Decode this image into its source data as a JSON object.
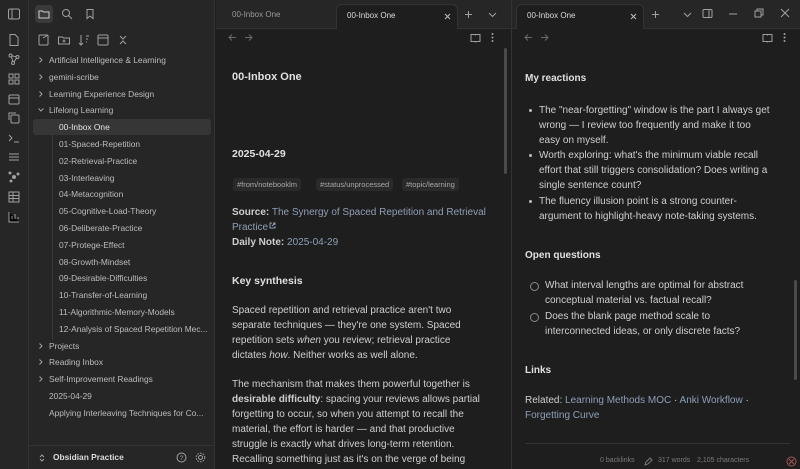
{
  "sidebar": {
    "items": [
      {
        "label": "Artificial Intelligence & Learning"
      },
      {
        "label": "gemini-scribe"
      },
      {
        "label": "Learning Experience Design"
      },
      {
        "label": "Lifelong Learning"
      },
      {
        "label": "00-Inbox One"
      },
      {
        "label": "01-Spaced-Repetition"
      },
      {
        "label": "02-Retrieval-Practice"
      },
      {
        "label": "03-Interleaving"
      },
      {
        "label": "04-Metacognition"
      },
      {
        "label": "05-Cognitive-Load-Theory"
      },
      {
        "label": "06-Deliberate-Practice"
      },
      {
        "label": "07-Protege-Effect"
      },
      {
        "label": "08-Growth-Mindset"
      },
      {
        "label": "09-Desirable-Difficulties"
      },
      {
        "label": "10-Transfer-of-Learning"
      },
      {
        "label": "11-Algorithmic-Memory-Models"
      },
      {
        "label": "12-Analysis of Spaced Repetition Mec..."
      },
      {
        "label": "Projects"
      },
      {
        "label": "Reading Inbox"
      },
      {
        "label": "Self-Improvement Readings"
      },
      {
        "label": "2025-04-29"
      },
      {
        "label": "Applying Interleaving Techniques for Co..."
      }
    ],
    "vault_name": "Obsidian Practice"
  },
  "left_pane": {
    "tabs": [
      {
        "label": "00-Inbox One"
      },
      {
        "label": "00-Inbox One"
      }
    ],
    "note_title": "00-Inbox One",
    "date_heading": "2025-04-29",
    "tags": [
      "#from/notebooklm",
      "#status/unprocessed",
      "#topic/learning"
    ],
    "source_label": "Source:",
    "source_link_line1": "The Synergy of Spaced Repetition and Retrieval",
    "source_link_line2": "Practice",
    "daily_note_label": "Daily Note:",
    "daily_note_link": "2025-04-29",
    "key_synthesis_heading": "Key synthesis",
    "para1": [
      "Spaced repetition and retrieval practice aren't two",
      "separate techniques — they're one system. Spaced",
      "repetition sets ",
      "when",
      " you review; retrieval practice",
      "dictates ",
      "how",
      ". Neither works as well alone."
    ],
    "para2": [
      "The mechanism that makes them powerful together is",
      "desirable difficulty",
      ": spacing your reviews allows partial",
      "forgetting to occur, so when you attempt to recall the",
      "material, the effort is harder — and that productive",
      "struggle is exactly what drives long-term retention.",
      "Recalling something just as it's on the verge of being"
    ]
  },
  "right_pane": {
    "tab_label": "00-Inbox One",
    "reactions_heading": "My reactions",
    "reactions": [
      [
        "The \"near-forgetting\" window is the part I always get",
        "wrong — I review too frequently and make it too",
        "easy on myself."
      ],
      [
        "Worth exploring: what's the minimum viable recall",
        "effort that still triggers consolidation? Does writing a",
        "single sentence count?"
      ],
      [
        "The fluency illusion point is a strong counter-",
        "argument to highlight-heavy note-taking systems."
      ]
    ],
    "open_questions_heading": "Open questions",
    "questions": [
      [
        "What interval lengths are optimal for abstract",
        "conceptual material vs. factual recall?"
      ],
      [
        "Does the blank page method scale to",
        "interconnected ideas, or only discrete facts?"
      ]
    ],
    "links_heading": "Links",
    "related_label": "Related: ",
    "related_links": [
      "Learning Methods MOC",
      "Anki Workflow",
      "Forgetting Curve"
    ],
    "separator": " · ",
    "status": {
      "backlinks": "0 backlinks",
      "words": "317 words",
      "chars": "2,105 characters"
    }
  },
  "colors": {
    "accent_link": "#8f9fb7",
    "background": "#1e1e1e",
    "sidebar": "#262626"
  }
}
